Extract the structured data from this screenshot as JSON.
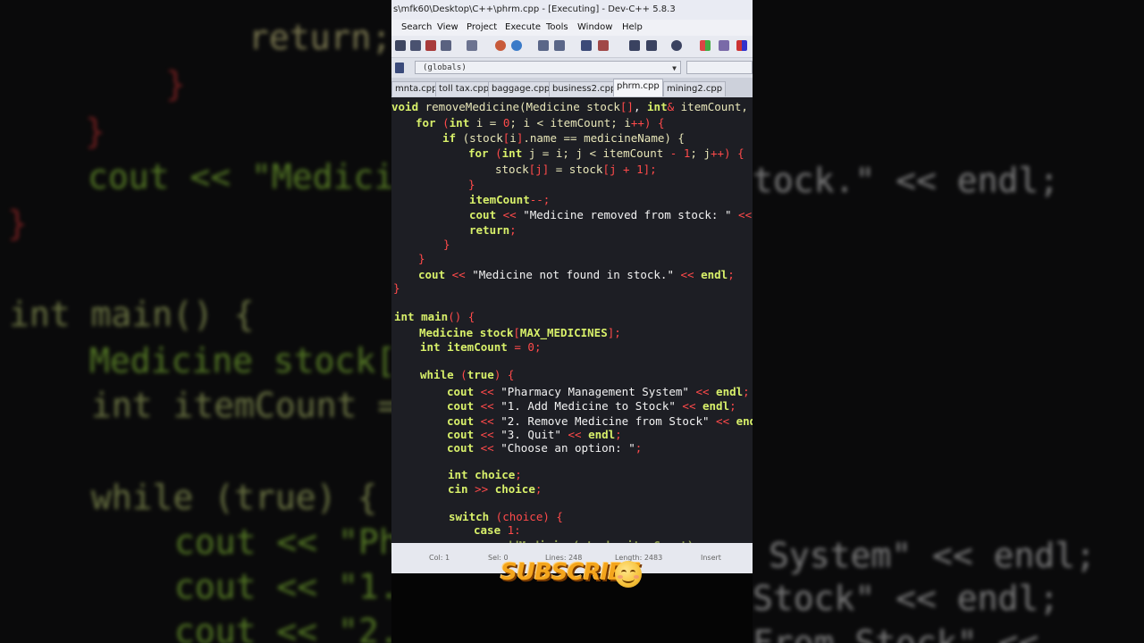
{
  "window": {
    "title": "s\\mfk60\\Desktop\\C++\\phrm.cpp - [Executing] - Dev-C++ 5.8.3"
  },
  "menu": [
    "Search",
    "View",
    "Project",
    "Execute",
    "Tools",
    "Window",
    "Help"
  ],
  "toolbar": {
    "scope_dropdown": "(globals)"
  },
  "tabs": [
    {
      "label": "mnta.cpp",
      "active": false
    },
    {
      "label": "toll tax.cpp",
      "active": false
    },
    {
      "label": "baggage.cpp",
      "active": false
    },
    {
      "label": "business2.cpp",
      "active": false
    },
    {
      "label": "phrm.cpp",
      "active": true
    },
    {
      "label": "mining2.cpp",
      "active": false
    }
  ],
  "code": {
    "l1": {
      "a": "void",
      "b": " removeMedicine(",
      "c": "Medicine stock",
      "d": "[]",
      "e": ", ",
      "f": "int",
      "g": "&",
      "h": " itemCount,"
    },
    "l2": {
      "a": "for",
      "b": " (",
      "c": "int",
      "d": " i = ",
      "e": "0",
      "f": "; i < itemCount; i",
      "g": "++",
      "h": ") {"
    },
    "l3": {
      "a": "if",
      "b": " (stock",
      "c": "[",
      "d": "i",
      "e": "]",
      "f": ".name == medicineName) {"
    },
    "l4": {
      "a": "for",
      "b": " (",
      "c": "int",
      "d": " j = i; j < itemCount ",
      "e": "- 1",
      "f": "; j",
      "g": "++",
      "h": ") {"
    },
    "l5": {
      "a": "stock",
      "b": "[j]",
      "c": " = ",
      "d": "stock",
      "e": "[j + ",
      "f": "1",
      "g": "];"
    },
    "l6": {
      "a": "}"
    },
    "l7": {
      "a": "itemCount",
      "b": "--;"
    },
    "l8": {
      "a": "cout",
      "b": " << ",
      "c": "\"Medicine removed from stock: \"",
      "d": " <<"
    },
    "l9": {
      "a": "return",
      "b": ";"
    },
    "l10": {
      "a": "}"
    },
    "l11": {
      "a": "}"
    },
    "l12": {
      "a": "cout",
      "b": " << ",
      "c": "\"Medicine not found in stock.\"",
      "d": " << ",
      "e": "endl",
      "f": ";"
    },
    "l13": {
      "a": "}"
    },
    "l14": {
      "a": "int",
      "b": " main",
      "c": "() {"
    },
    "l15": {
      "a": "Medicine stock",
      "b": "[",
      "c": "MAX_MEDICINES",
      "d": "];"
    },
    "l16": {
      "a": "int",
      "b": " itemCount",
      "c": " = ",
      "d": "0",
      "e": ";"
    },
    "l17": {
      "a": "while",
      "b": " (",
      "c": "true",
      "d": ") {"
    },
    "l18": {
      "a": "cout",
      "b": " << ",
      "c": "\"Pharmacy Management System\"",
      "d": " << ",
      "e": "endl",
      "f": ";"
    },
    "l19": {
      "a": "cout",
      "b": " << ",
      "c": "\"1. Add Medicine to Stock\"",
      "d": " << ",
      "e": "endl",
      "f": ";"
    },
    "l20": {
      "a": "cout",
      "b": " << ",
      "c": "\"2. Remove Medicine from Stock\"",
      "d": " << ",
      "e": "endl"
    },
    "l21": {
      "a": "cout",
      "b": " << ",
      "c": "\"3. Quit\"",
      "d": " << ",
      "e": "endl",
      "f": ";"
    },
    "l22": {
      "a": "cout",
      "b": " << ",
      "c": "\"Choose an option: \"",
      "d": ";"
    },
    "l23": {
      "a": "int",
      "b": " choice",
      "c": ";"
    },
    "l24": {
      "a": "cin",
      "b": " >> ",
      "c": "choice",
      "d": ";"
    },
    "l25": {
      "a": "switch",
      "b": " (choice) {"
    },
    "l26": {
      "a": "case",
      "b": " 1:"
    },
    "l27": {
      "a": "addMedicine(stock, itemCount);"
    }
  },
  "status": {
    "col": "Col: 1",
    "sel": "Sel: 0",
    "lines": "Lines: 248",
    "length": "Length: 2483",
    "mode": "Insert"
  },
  "overlay": {
    "subscribe": "SUBSCRIBE"
  },
  "background_code": {
    "b1": "return;",
    "b2": "}",
    "b3": "}",
    "b4": "cout << \"Medici",
    "b5": "}",
    "b6": "int main() {",
    "b7": "Medicine stock[",
    "b8": "int itemCount =",
    "b9": "while (true) {",
    "b10": "cout << \"Ph",
    "b11": "cout << \"1.",
    "b12": "cout << \"2.",
    "r1": "tock.\" << endl;",
    "r2": "System\" << endl;",
    "r3": "Stock\" << endl;",
    "r4": "From Stock\" <<"
  },
  "colors": {
    "editor_bg": "#1d1e24",
    "keyword_green": "#d8f06a",
    "symbol_red": "#ff4a4a",
    "subscribe_orange": "#f4a51c"
  }
}
